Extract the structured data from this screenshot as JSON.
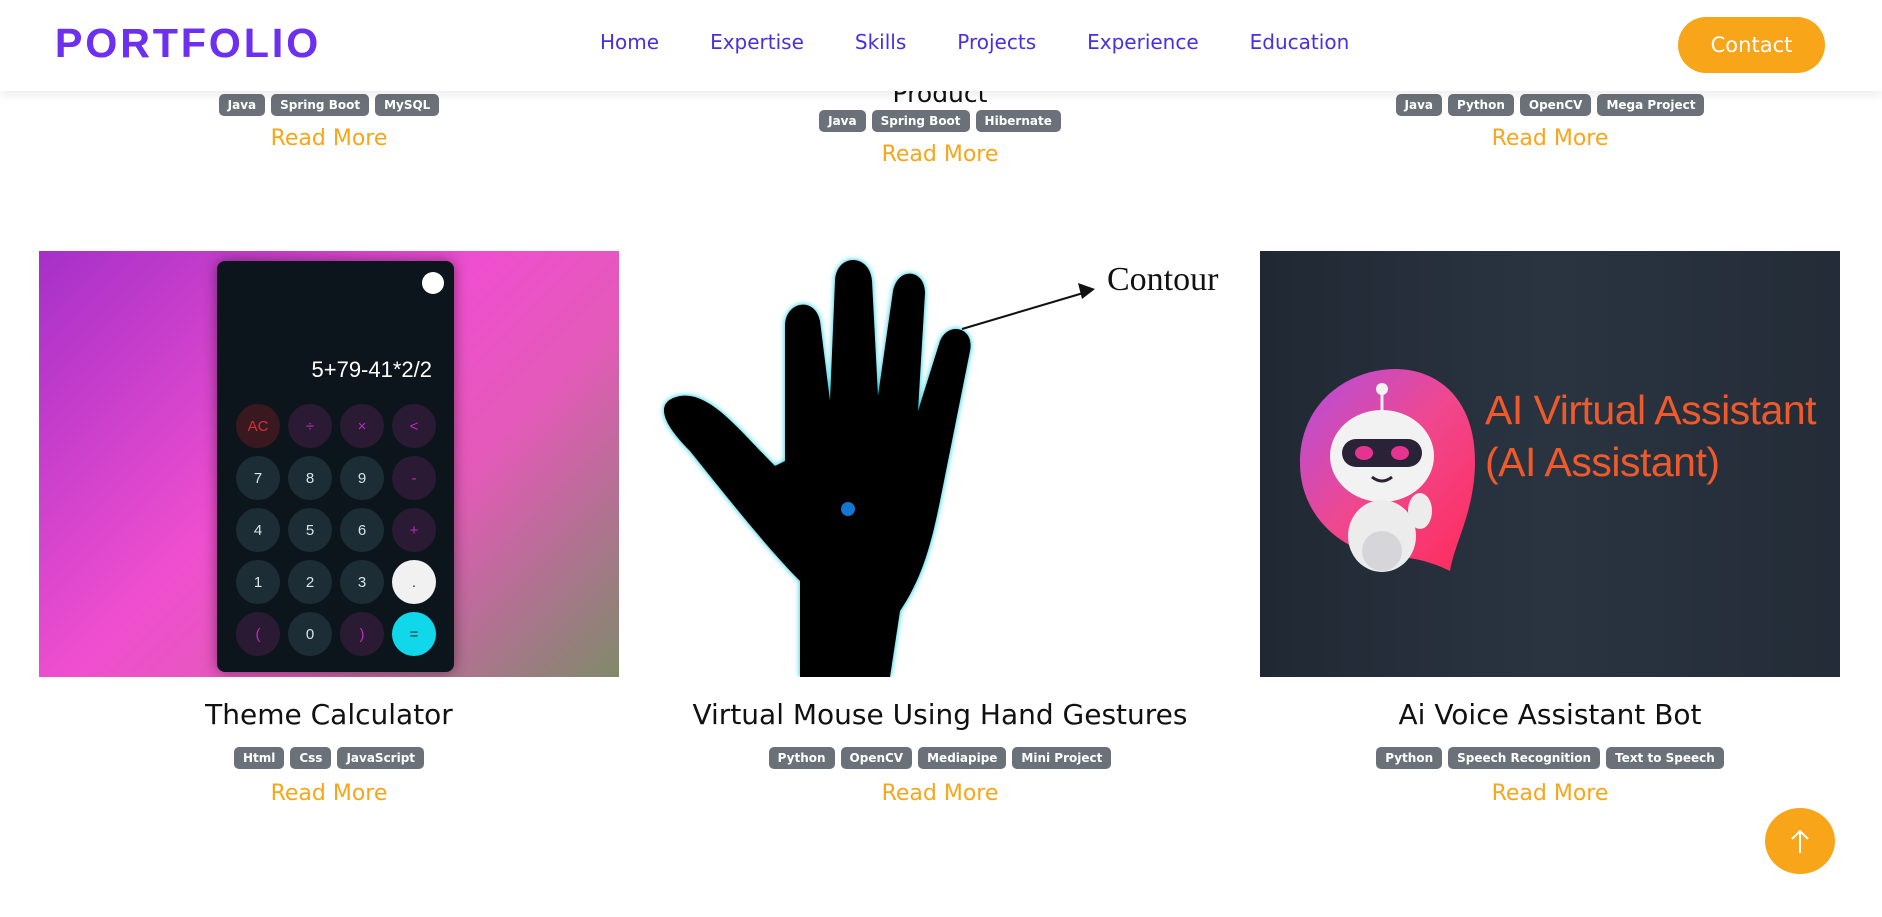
{
  "nav": {
    "logo": "PORTFOLIO",
    "links": [
      "Home",
      "Expertise",
      "Skills",
      "Projects",
      "Experience",
      "Education"
    ],
    "contact_label": "Contact"
  },
  "top_cards": [
    {
      "title": "",
      "tags": [
        "Java",
        "Spring Boot",
        "MySQL"
      ],
      "read_more": "Read More"
    },
    {
      "title": "Product",
      "tags": [
        "Java",
        "Spring Boot",
        "Hibernate"
      ],
      "read_more": "Read More"
    },
    {
      "title": "",
      "tags": [
        "Java",
        "Python",
        "OpenCV",
        "Mega Project"
      ],
      "read_more": "Read More"
    }
  ],
  "projects": [
    {
      "title": "Theme Calculator",
      "tags": [
        "Html",
        "Css",
        "JavaScript"
      ],
      "read_more": "Read More",
      "image": {
        "display": "5+79-41*2/2",
        "keys": [
          "AC",
          "÷",
          "×",
          "<",
          "7",
          "8",
          "9",
          "-",
          "4",
          "5",
          "6",
          "+",
          "1",
          "2",
          "3",
          ".",
          "(",
          "0",
          ")",
          "="
        ]
      }
    },
    {
      "title": "Virtual Mouse Using Hand Gestures",
      "tags": [
        "Python",
        "OpenCV",
        "Mediapipe",
        "Mini Project"
      ],
      "read_more": "Read More",
      "image": {
        "label": "Contour"
      }
    },
    {
      "title": "Ai Voice Assistant Bot",
      "tags": [
        "Python",
        "Speech Recognition",
        "Text to Speech"
      ],
      "read_more": "Read More",
      "image": {
        "line1": "AI Virtual Assistant",
        "line2": "(AI Assistant)"
      }
    }
  ],
  "colors": {
    "accent": "#f9a51a",
    "nav_text": "#4a2fe0",
    "logo": "#6d2ff0",
    "tag_bg": "#6b7178"
  },
  "icons": {
    "scroll_top": "arrow-up-icon"
  }
}
